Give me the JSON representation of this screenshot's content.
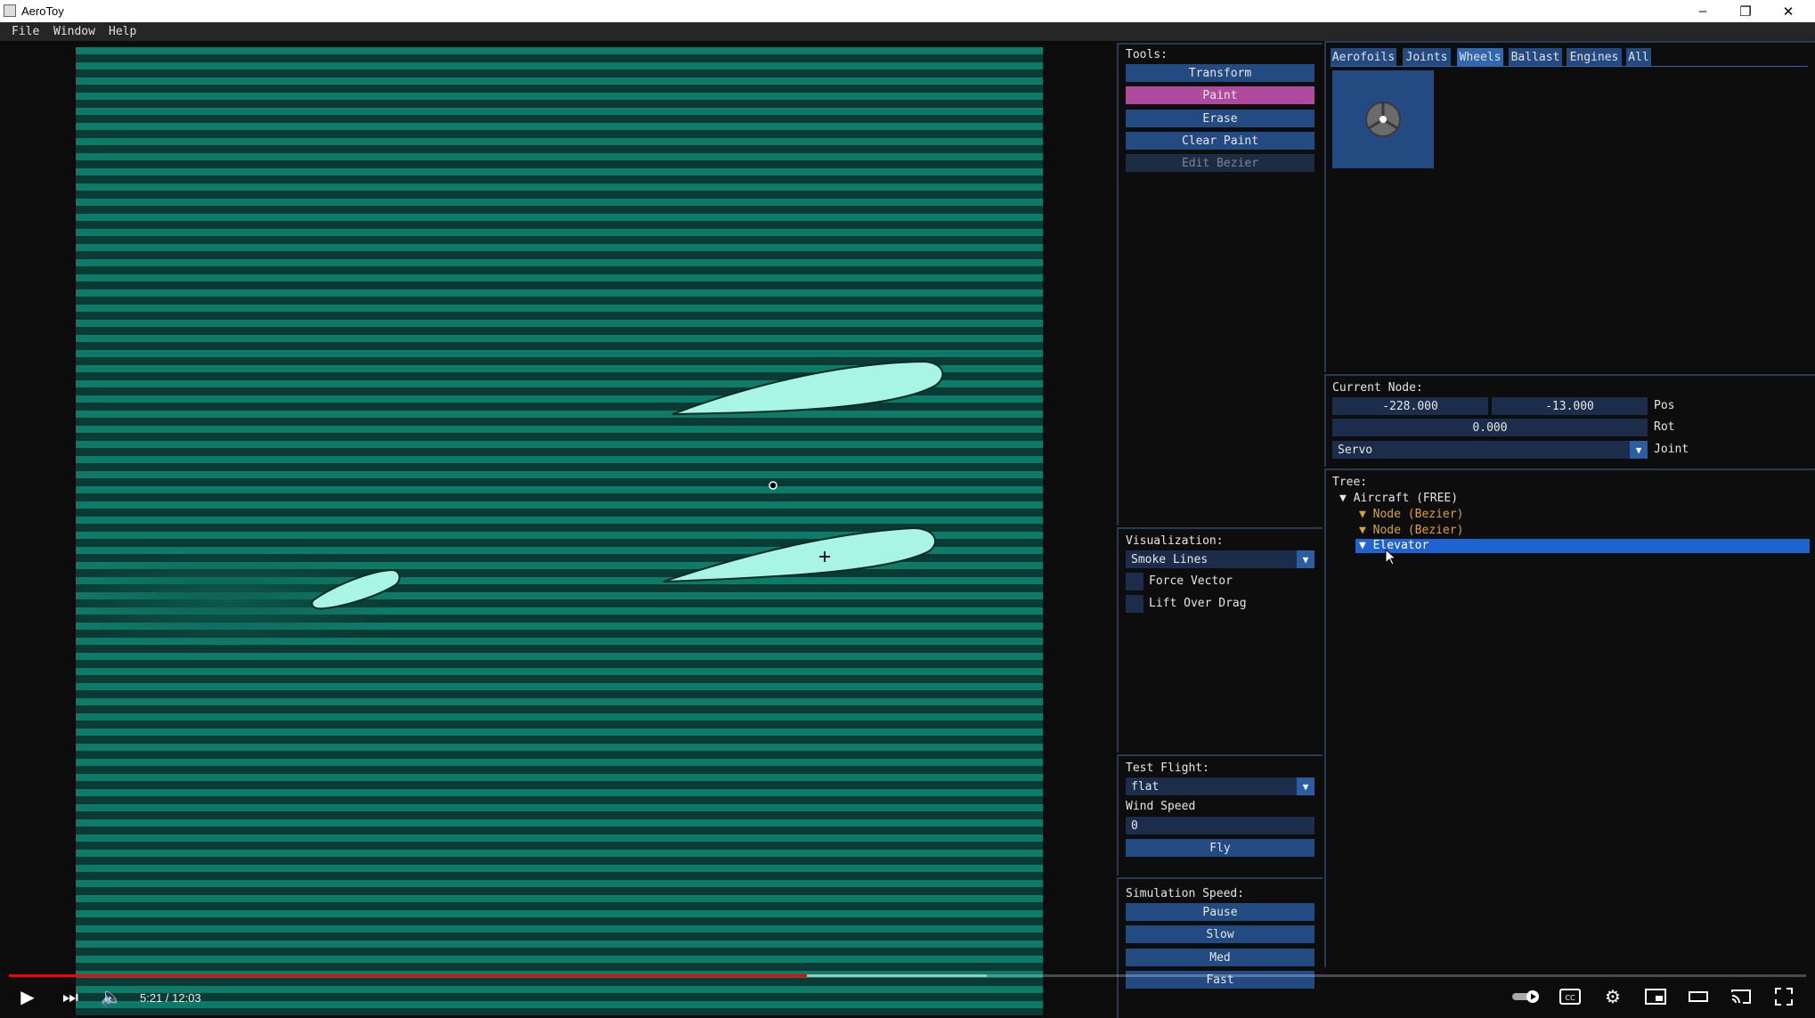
{
  "window": {
    "title": "AeroToy"
  },
  "menu": [
    "File",
    "Window",
    "Help"
  ],
  "tools": {
    "label": "Tools:",
    "buttons": [
      {
        "label": "Transform",
        "state": "normal"
      },
      {
        "label": "Paint",
        "state": "active"
      },
      {
        "label": "Erase",
        "state": "normal"
      },
      {
        "label": "Clear Paint",
        "state": "normal"
      },
      {
        "label": "Edit Bezier",
        "state": "disabled"
      }
    ]
  },
  "visualization": {
    "label": "Visualization:",
    "mode": "Smoke Lines",
    "force_vector": {
      "label": "Force Vector",
      "checked": false
    },
    "lift_over_drag": {
      "label": "Lift Over Drag",
      "checked": false
    }
  },
  "test_flight": {
    "label": "Test Flight:",
    "profile": "flat",
    "wind_speed_label": "Wind Speed",
    "wind_speed": "0",
    "fly_label": "Fly"
  },
  "simulation_speed": {
    "label": "Simulation Speed:",
    "buttons": [
      "Pause",
      "Slow",
      "Med",
      "Fast"
    ]
  },
  "parts": {
    "tabs": [
      "Aerofoils",
      "Joints",
      "Wheels",
      "Ballast",
      "Engines",
      "All"
    ],
    "active_tab": "Wheels",
    "thumbnail_icon": "wheel-icon"
  },
  "current_node": {
    "label": "Current Node:",
    "pos_x": "-228.000",
    "pos_y": "-13.000",
    "pos_label": "Pos",
    "rot": "0.000",
    "rot_label": "Rot",
    "joint": "Servo",
    "joint_label": "Joint"
  },
  "tree": {
    "label": "Tree:",
    "root": "Aircraft (FREE)",
    "nodes": [
      "Node (Bezier)",
      "Node (Bezier)"
    ],
    "selected": "Elevator"
  },
  "video": {
    "time": "5:21 / 12:03",
    "played_fraction": 0.444,
    "buffered_fraction": 0.544
  },
  "colors": {
    "accent": "#234b82",
    "paint_active": "#b04a9e",
    "flow_dark": "#0a3a33",
    "flow_light": "#0e7a68",
    "aerofoil": "#a8f5e6",
    "tree_node": "#d8a33a",
    "selected": "#1f63d0"
  }
}
